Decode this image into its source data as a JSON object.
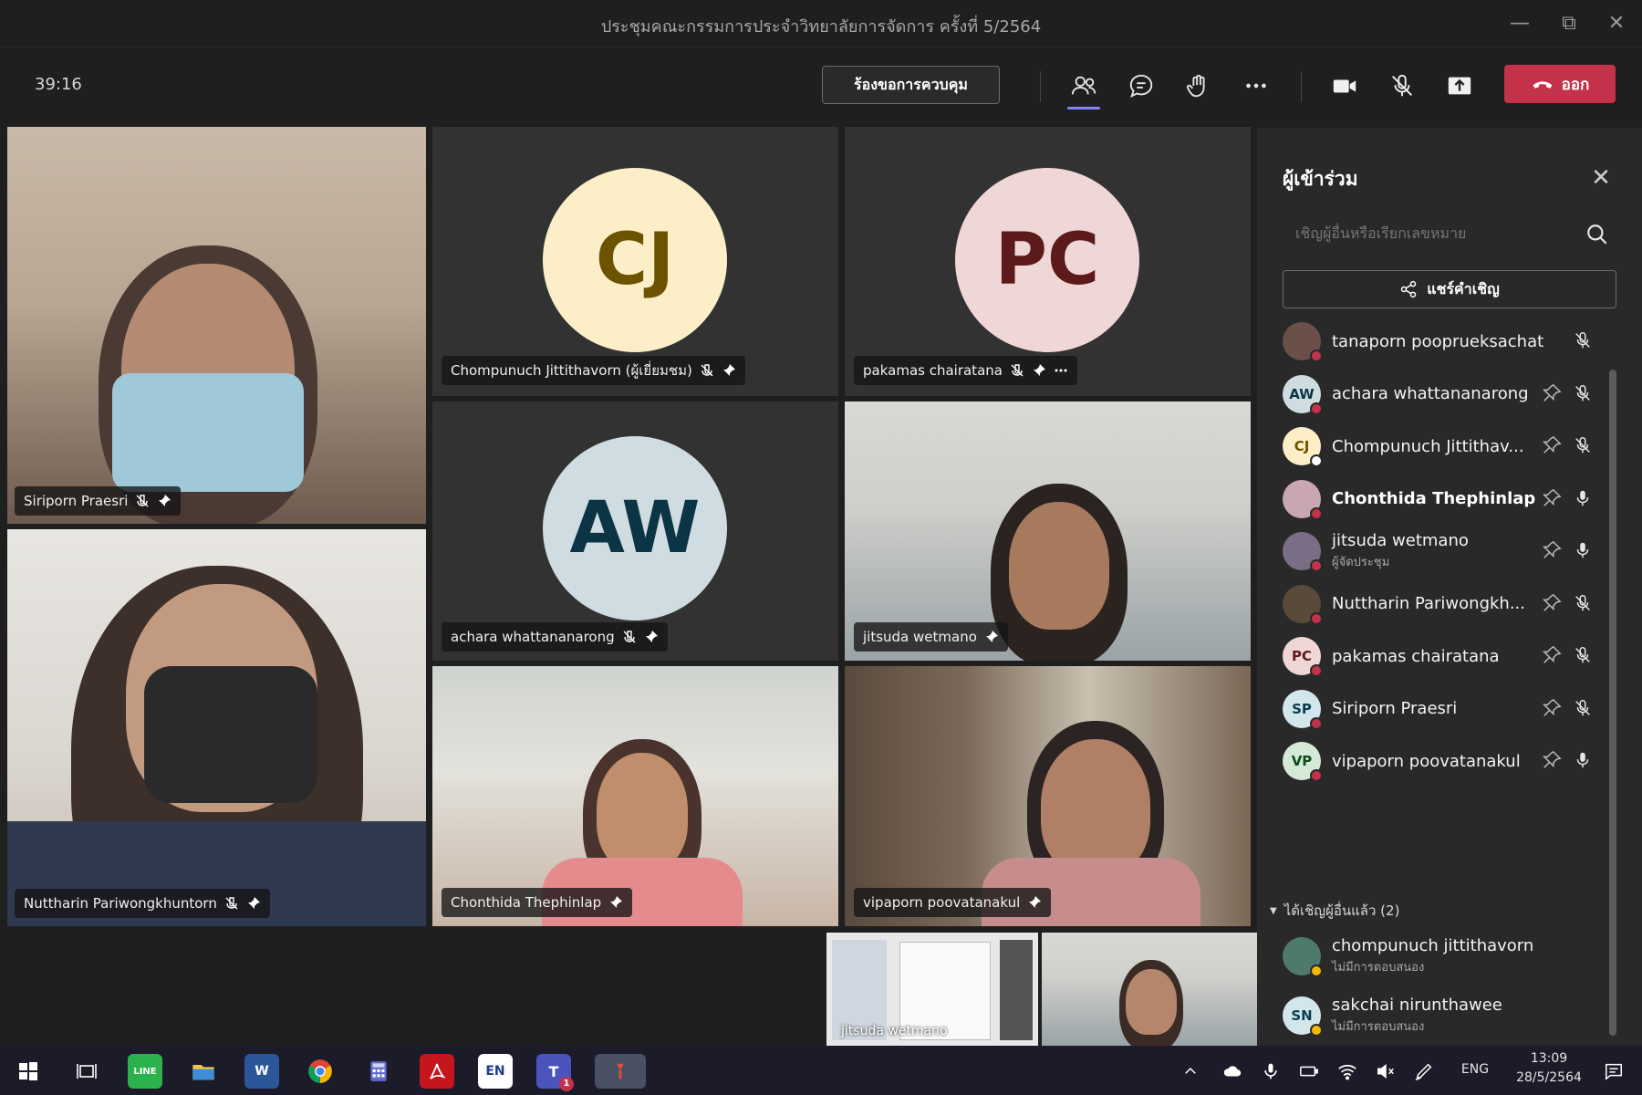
{
  "window": {
    "title": "ประชุมคณะกรรมการประจำวิทยาลัยการจัดการ ครั้งที่ 5/2564"
  },
  "toolbar": {
    "timer": "39:16",
    "request_control_label": "ร้องขอการควบคุม",
    "leave_label": "ออก"
  },
  "tiles": [
    {
      "name": "Siriporn Praesri",
      "kind": "video"
    },
    {
      "name": "Chompunuch Jittithavorn (ผู้เยี่ยมชม)",
      "kind": "avatar",
      "initials": "CJ",
      "bg": "#fcefc7",
      "fg": "#6b5300"
    },
    {
      "name": "pakamas chairatana",
      "kind": "avatar",
      "initials": "PC",
      "bg": "#f0d7d7",
      "fg": "#5c1a1a"
    },
    {
      "name": "achara whattananarong",
      "kind": "avatar",
      "initials": "AW",
      "bg": "#cfdde3",
      "fg": "#0b3444"
    },
    {
      "name": "jitsuda wetmano",
      "kind": "video"
    },
    {
      "name": "Nuttharin Pariwongkhuntorn",
      "kind": "video"
    },
    {
      "name": "Chonthida Thephinlap",
      "kind": "video"
    },
    {
      "name": "vipaporn poovatanakul",
      "kind": "video"
    }
  ],
  "thumbs": [
    {
      "name": "jitsuda wetmano"
    }
  ],
  "panel": {
    "title": "ผู้เข้าร่วม",
    "invite_placeholder": "เชิญผู้อื่นหรือเรียกเลขหมาย",
    "share_label": "แชร์คำเชิญ",
    "participants": [
      {
        "name": "tanaporn pooprueksachat",
        "initials": "",
        "avatar_bg": "#6a5048",
        "pin": false,
        "mic": "muted",
        "status": "#c4314b"
      },
      {
        "name": "achara whattananarong",
        "initials": "AW",
        "avatar_bg": "#cfdde3",
        "avatar_fg": "#0b3444",
        "pin": true,
        "mic": "muted",
        "status": "#c4314b"
      },
      {
        "name": "Chompunuch Jittithav...",
        "initials": "CJ",
        "avatar_bg": "#fcefc7",
        "avatar_fg": "#6b5300",
        "pin": true,
        "mic": "muted",
        "status": "#ffffff"
      },
      {
        "name": "Chonthida Thephinlap",
        "initials": "",
        "avatar_bg": "#c9a7b0",
        "pin": true,
        "mic": "on",
        "status": "#c4314b",
        "bold": true
      },
      {
        "name": "jitsuda wetmano",
        "role": "ผู้จัดประชุม",
        "initials": "",
        "avatar_bg": "#7a6e86",
        "pin": true,
        "mic": "on",
        "status": "#c4314b"
      },
      {
        "name": "Nuttharin Pariwongkh...",
        "initials": "",
        "avatar_bg": "#5a4a3a",
        "pin": true,
        "mic": "muted",
        "status": "#c4314b"
      },
      {
        "name": "pakamas chairatana",
        "initials": "PC",
        "avatar_bg": "#f0d7d7",
        "avatar_fg": "#5c1a1a",
        "pin": true,
        "mic": "muted",
        "status": "#c4314b"
      },
      {
        "name": "Siriporn Praesri",
        "initials": "SP",
        "avatar_bg": "#d2e6ec",
        "avatar_fg": "#0b3d4f",
        "pin": true,
        "mic": "muted",
        "status": "#c4314b"
      },
      {
        "name": "vipaporn poovatanakul",
        "initials": "VP",
        "avatar_bg": "#d5ead6",
        "avatar_fg": "#0e4a1e",
        "pin": true,
        "mic": "on",
        "status": "#c4314b"
      }
    ],
    "invited_header": "ได้เชิญผู้อื่นแล้ว (2)",
    "invited": [
      {
        "name": "chompunuch jittithavorn",
        "sub": "ไม่มีการตอบสนอง",
        "initials": "",
        "avatar_bg": "#4d7a6a",
        "status": "#f5b800"
      },
      {
        "name": "sakchai nirunthawee",
        "sub": "ไม่มีการตอบสนอง",
        "initials": "SN",
        "avatar_bg": "#d2e6ec",
        "avatar_fg": "#0b3d4f",
        "status": "#f5b800"
      }
    ]
  },
  "taskbar": {
    "apps": [
      "windows-start",
      "task-view",
      "line",
      "file-explorer",
      "word",
      "chrome",
      "calculator",
      "acrobat",
      "en-app",
      "teams",
      "app-active"
    ],
    "lang": "ENG",
    "time": "13:09",
    "date": "28/5/2564",
    "word_label": "W",
    "en_label": "EN",
    "line_label": "LINE",
    "teams_badge": "1"
  },
  "colors": {
    "accent": "#7f85f5",
    "leave": "#c4314b"
  }
}
